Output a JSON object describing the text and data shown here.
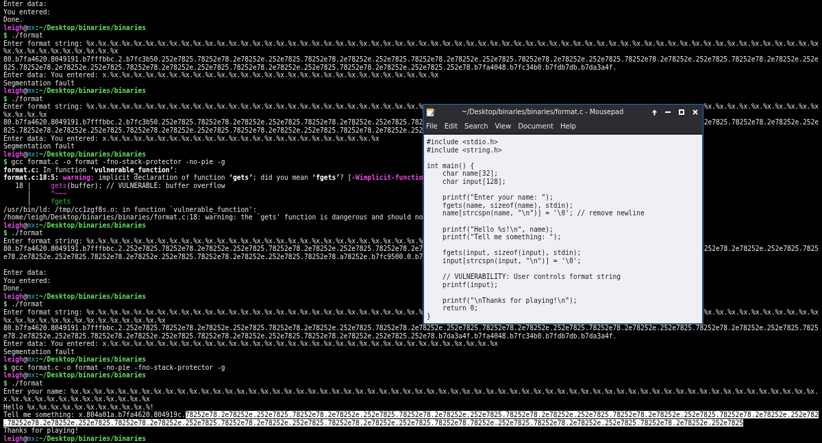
{
  "terminal": {
    "lines": [
      {
        "spans": [
          {
            "text": "Enter data:"
          }
        ]
      },
      {
        "spans": [
          {
            "text": "You entered:"
          }
        ]
      },
      {
        "spans": [
          {
            "text": "Done."
          }
        ]
      },
      {
        "spans": [
          {
            "text": "leigh",
            "kind": "user"
          },
          {
            "text": "@"
          },
          {
            "text": "mx",
            "kind": "host"
          },
          {
            "text": ":~/Desktop/binaries/binaries",
            "kind": "path"
          }
        ]
      },
      {
        "spans": [
          {
            "text": "$",
            "kind": "path"
          },
          {
            "text": " ./format"
          }
        ]
      },
      {
        "spans": [
          {
            "text": "Enter format string: %x.%x.%x.%x.%x.%x.%x.%x.%x.%x.%x.%x.%x.%x.%x.%x.%x.%x.%x.%x.%x.%x.%x.%x.%x.%x.%x.%x.%x.%x.%x.%x.%x.%x.%x.%x.%x.%x.%x.%x.%x.%x.%x.%x.%x.%x.%x.%x.%x.%x.%x.%x.%x.%x.%x.%x.%x.%x.%x.%x.%x.%x"
          }
        ]
      },
      {
        "spans": [
          {
            "text": "%x.%x.%x.%x.%x.%x.%x.%x.%x.%x"
          }
        ]
      },
      {
        "spans": [
          {
            "text": "80.b7fa4620.8049191.b7fffbbc.2.b7fc3b50.252e7825.78252e78.2e78252e.252e7825.78252e78.2e78252e.252e7825.78252e78.2e78252e.252e7825.78252e78.2e78252e.252e7825.78252e78.2e78252e.252e7825.78252e78.2e78252e.252e"
          }
        ]
      },
      {
        "spans": [
          {
            "text": "825.78252e78.2e78252e.252e7825.78252e78.2e78252e.252e7825.78252e78.2e78252e.252e7825.78252e78.2e78252e.252e7825.252e78.b7fa4048.b7fc34b0.b7fdb7db.b7da3a4f."
          }
        ]
      },
      {
        "spans": [
          {
            "text": "Enter data: You entered: x.%x.%x.%x.%x.%x.%x.%x.%x.%x.%x.%x.%x.%x.%x.%x.%x.%x.%x.%x.%x.%x.%x.%x.%x.%x.%x.%x.%x"
          }
        ]
      },
      {
        "spans": [
          {
            "text": "Segmentation fault"
          }
        ]
      },
      {
        "spans": [
          {
            "text": "leigh",
            "kind": "user"
          },
          {
            "text": "@"
          },
          {
            "text": "mx",
            "kind": "host"
          },
          {
            "text": ":~/Desktop/binaries/binaries",
            "kind": "path"
          }
        ]
      },
      {
        "spans": [
          {
            "text": "$",
            "kind": "path"
          },
          {
            "text": " ./format"
          }
        ]
      },
      {
        "spans": [
          {
            "text": "Enter format string: %x.%x.%x.%x.%x.%x.%x.%x.%x.%x.%x.%x.%x.%x.%x.%x.%x.%x.%x.%x.%x.%x.%x.%x.%x.%x.%x.%x.%"
          }
        ],
        "right": "%x.%x.%x.%x.%x.%x.%x.%x.%x.%x"
      },
      {
        "spans": [
          {
            "text": "%x.%x.%x.%x"
          }
        ]
      },
      {
        "spans": [
          {
            "text": "80.b7fa4620.8049191.b7fffbbc.2.b7fc3b50.252e7825.78252e78.2e78252e.252e7825.78252e78.2e78252e.252e7825.782"
          }
        ],
        "right": "2e7825.78252e78.2e78252e.252e"
      },
      {
        "spans": [
          {
            "text": "825.78252e78.2e78252e.252e7825.78252e78.2e78252e.252e7825.78252e78.2e78252e.252e7825.78252e78.2e78252e.252"
          }
        ]
      },
      {
        "spans": [
          {
            "text": "Enter data: You entered: x.%x.%x.%x.%x.%x.%x.%x.%x.%x.%x.%x.%x.%x.%x.%x.%x.%x.%x.%x.%x.%x.%x.%x"
          }
        ]
      },
      {
        "spans": [
          {
            "text": "Segmentation fault"
          }
        ]
      },
      {
        "spans": [
          {
            "text": "leigh",
            "kind": "user"
          },
          {
            "text": "@"
          },
          {
            "text": "mx",
            "kind": "host"
          },
          {
            "text": ":~/Desktop/binaries/binaries",
            "kind": "path"
          }
        ]
      },
      {
        "spans": [
          {
            "text": "$",
            "kind": "path"
          },
          {
            "text": " gcc format.c -o format -fno-stack-protector -no-pie -g"
          }
        ]
      },
      {
        "spans": [
          {
            "text": "format.c:",
            "kind": "bold"
          },
          {
            "text": " In function "
          },
          {
            "text": "‘vulnerable_function’",
            "kind": "bold"
          },
          {
            "text": ":"
          }
        ]
      },
      {
        "spans": [
          {
            "text": "format.c:18:5: ",
            "kind": "bold"
          },
          {
            "text": "warning:",
            "kind": "warning"
          },
          {
            "text": " implicit declaration of function "
          },
          {
            "text": "‘gets’",
            "kind": "bold"
          },
          {
            "text": "; did you mean "
          },
          {
            "text": "‘fgets’",
            "kind": "bold"
          },
          {
            "text": "? ["
          },
          {
            "text": "-Wimplicit-functio",
            "kind": "warning"
          }
        ]
      },
      {
        "spans": [
          {
            "text": "   18 |     "
          },
          {
            "text": "gets",
            "kind": "marker"
          },
          {
            "text": "(buffer); // VULNERABLE: buffer overflow"
          }
        ]
      },
      {
        "spans": [
          {
            "text": "      |     "
          },
          {
            "text": "^~~~",
            "kind": "marker"
          }
        ]
      },
      {
        "spans": [
          {
            "text": "      |     "
          },
          {
            "text": "fgets",
            "kind": "fixit"
          }
        ]
      },
      {
        "spans": [
          {
            "text": "/usr/bin/ld: /tmp/cc1zgf8s.o: in function `vulnerable_function':"
          }
        ]
      },
      {
        "spans": [
          {
            "text": "/home/leigh/Desktop/binaries/binaries/format.c:18: warning: the `gets' function is dangerous and should no"
          }
        ]
      },
      {
        "spans": [
          {
            "text": "leigh",
            "kind": "user"
          },
          {
            "text": "@"
          },
          {
            "text": "mx",
            "kind": "host"
          },
          {
            "text": ":~/Desktop/binaries/binaries",
            "kind": "path"
          }
        ]
      },
      {
        "spans": [
          {
            "text": "$",
            "kind": "path"
          },
          {
            "text": " ./format"
          }
        ]
      },
      {
        "spans": [
          {
            "text": "Enter format string: %x.%x.%x.%x.%x.%x.%x.%x.%x.%x.%x.%x.%x.%x.%x.%x.%x.%x.%x.%x.%x.%x.%x.%x.%x.%x.%x.%x.%"
          }
        ]
      },
      {
        "spans": [
          {
            "text": "80.b7fa4620.8049191.b7fffbbc.2.252e7825.78252e78.2e78252e.252e7825.78252e78.2e78252e.252e7825.78252e78.2e7"
          }
        ],
        "right": "252e78.2e78252e.252e7825.7825"
      },
      {
        "spans": [
          {
            "text": "e78.2e78252e.252e7825.78252e78.2e78252e.252e7825.78252e78.2e78252e.252e7825.78252e78.a78252e.b7fc9500.0.b7"
          }
        ]
      },
      {
        "kind": "blank"
      },
      {
        "spans": [
          {
            "text": "Enter data:"
          }
        ]
      },
      {
        "spans": [
          {
            "text": "You entered:"
          }
        ]
      },
      {
        "spans": [
          {
            "text": "Done."
          }
        ]
      },
      {
        "spans": [
          {
            "text": "leigh",
            "kind": "user"
          },
          {
            "text": "@"
          },
          {
            "text": "mx",
            "kind": "host"
          },
          {
            "text": ":~/Desktop/binaries/binaries",
            "kind": "path"
          }
        ]
      },
      {
        "spans": [
          {
            "text": "$",
            "kind": "path"
          },
          {
            "text": " ./format"
          }
        ]
      },
      {
        "spans": [
          {
            "text": "Enter format string: %x.%x.%x.%x.%x.%x.%x.%x.%x.%x.%x.%x.%x.%x.%x.%x.%x.%x.%x.%x.%x.%x.%x.%x.%x.%x.%x.%x.%"
          }
        ],
        "right": "%x.%x.%x.%x.%x.%x.%x.%x.%x.%x"
      },
      {
        "spans": [
          {
            "text": "%x.%x.%x.%x.%x.%x.%x.%x.%x.%x.%x.%x.%x.%x"
          }
        ]
      },
      {
        "spans": [
          {
            "text": "80.b7fa4620.8049191.b7fffbbc.2.252e7825.78252e78.2e78252e.252e7825.78252e78.2e78252e.252e7825.78252e78.2e78252e.252e7825.78252e78.2e78252e.252e7825.78252e78.2e78252e.252e7825.78252e78.2e78252e.252e7825.7825"
          }
        ]
      },
      {
        "spans": [
          {
            "text": "e78.2e78252e.252e7825.78252e78.2e78252e.252e7825.78252e78.2e78252e.252e7825.78252e78.2e78252e.252e7825.252e78.b7da3a4f.b7fa4048.b7fc34b0.b7fdb7db.b7da3a4f."
          }
        ]
      },
      {
        "spans": [
          {
            "text": "Enter data: You entered: x.%x.%x.%x.%x.%x.%x.%x.%x.%x.%x.%x.%x.%x.%x.%x.%x.%x.%x.%x.%x.%x.%x.%x.%x.%x.%x.%x.%x.%x.%x.%x.%x.%x"
          }
        ]
      },
      {
        "spans": [
          {
            "text": "Segmentation fault"
          }
        ]
      },
      {
        "spans": [
          {
            "text": "leigh",
            "kind": "user"
          },
          {
            "text": "@"
          },
          {
            "text": "mx",
            "kind": "host"
          },
          {
            "text": ":~/Desktop/binaries/binaries",
            "kind": "path"
          }
        ]
      },
      {
        "spans": [
          {
            "text": "$",
            "kind": "path"
          },
          {
            "text": " gcc format.c -o format -no-pie -fno-stack-protector -g"
          }
        ]
      },
      {
        "spans": [
          {
            "text": "leigh",
            "kind": "user"
          },
          {
            "text": "@"
          },
          {
            "text": "mx",
            "kind": "host"
          },
          {
            "text": ":~/Desktop/binaries/binaries",
            "kind": "path"
          }
        ]
      },
      {
        "spans": [
          {
            "text": "$",
            "kind": "path"
          },
          {
            "text": " ./format"
          }
        ]
      },
      {
        "spans": [
          {
            "text": "Enter your name: %x.%x.%x.%x.%x.%x.%x.%x.%x.%x.%x.%x.%x.%x.%x.%x.%x.%x.%x.%x.%x.%x.%x.%x.%x.%x.%x.%x.%x.%x.%x.%x.%x.%x.%x.%x.%x.%x.%x.%x.%x.%x.%x.%x.%x.%x.%x.%x.%x.%x.%x.%x.%x.%x.%x.%x.%x.%x.%x.%x.%x.%x.%x."
          }
        ]
      },
      {
        "spans": [
          {
            "text": "x.%x.%x.%x.%x.%x.%x.%x.%x.%x.%x.%x.%x"
          }
        ]
      },
      {
        "spans": [
          {
            "text": "Hello %x.%x.%x.%x.%x.%x.%x.%x.%x.%x.%!"
          }
        ]
      },
      {
        "spans": [
          {
            "text": "Tell me something: x.804a01a.b7fa4620.804919c."
          },
          {
            "text": "78252e78.2e78252e.252e7825.78252e78.2e78252e.252e7825.78252e78.2e78252e.252e7825.78252e78.2e78252e.252e7825.78252e78.2e78252e.252e7825.78252e78.2e78252e.252e782",
            "kind": "selected"
          }
        ]
      },
      {
        "spans": [
          {
            "text": ".78252e78.2e78252e.252e7825.78252e78.2e78252e.252e7825.78252e78.2e78252e.252e7825.78252e78.2e78252e.252e7825.78252e78.78252e.252e7825.78252e78.2e78252e.252e7825.78252e78.2e78252e.252e7825",
            "kind": "selected"
          }
        ]
      },
      {
        "spans": [
          {
            "text": "Thanks for playing!"
          }
        ]
      },
      {
        "spans": [
          {
            "text": "leigh",
            "kind": "user"
          },
          {
            "text": "@"
          },
          {
            "text": "mx",
            "kind": "host"
          },
          {
            "text": ":~/Desktop/binaries/binaries",
            "kind": "path"
          }
        ]
      }
    ]
  },
  "editor": {
    "title": "~/Desktop/binaries/binaries/format.c - Mousepad",
    "menu": [
      "File",
      "Edit",
      "Search",
      "View",
      "Document",
      "Help"
    ],
    "code_blocks": [
      [
        "#include <stdio.h>",
        "#include <string.h>"
      ],
      [
        "int main() {",
        "    char name[32];",
        "    char input[128];"
      ],
      [
        "    printf(\"Enter your name: \");",
        "    fgets(name, sizeof(name), stdin);",
        "    name[strcspn(name, \"\\n\")] = '\\0'; // remove newline"
      ],
      [
        "    printf(\"Hello %s!\\n\", name);",
        "    printf(\"Tell me something: \");"
      ],
      [
        "    fgets(input, sizeof(input), stdin);",
        "    input[strcspn(input, \"\\n\")] = '\\0';"
      ],
      [
        "    // VULNERABILITY: User controls format string",
        "    printf(input);"
      ],
      [
        "    printf(\"\\nThanks for playing!\\n\");",
        "    return 0;",
        "}"
      ]
    ]
  }
}
